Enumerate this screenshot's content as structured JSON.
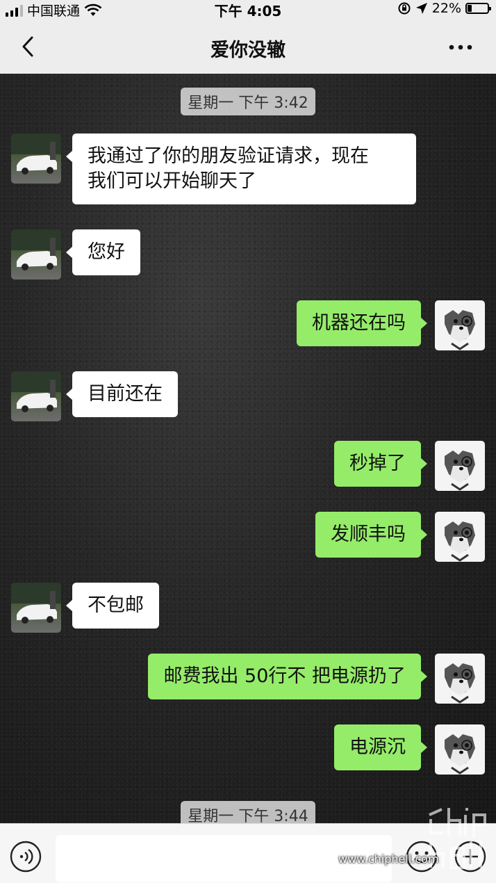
{
  "status_bar": {
    "carrier": "中国联通",
    "time": "下午 4:05",
    "battery_percent": "22%",
    "battery_level": 0.22
  },
  "nav": {
    "title": "爱你没辙",
    "back_icon": "chevron-left-icon",
    "more_icon": "more-dots-icon"
  },
  "chat": {
    "timestamps": [
      "星期一 下午 3:42",
      "星期一 下午 3:44"
    ],
    "messages": [
      {
        "side": "left",
        "text_line1": "我通过了你的朋友验证请求，现在",
        "text_line2": "我们可以开始聊天了"
      },
      {
        "side": "left",
        "text": "您好"
      },
      {
        "side": "right",
        "text": "机器还在吗"
      },
      {
        "side": "left",
        "text": "目前还在"
      },
      {
        "side": "right",
        "text": "秒掉了"
      },
      {
        "side": "right",
        "text": "发顺丰吗"
      },
      {
        "side": "left",
        "text": "不包邮"
      },
      {
        "side": "right",
        "text": "邮费我出 50行不 把电源扔了"
      },
      {
        "side": "right",
        "text": "电源沉"
      }
    ]
  },
  "input_bar": {
    "voice_icon": "voice-icon",
    "emoji_icon": "emoji-icon",
    "plus_icon": "plus-icon",
    "input_value": ""
  },
  "watermark": {
    "text": "www.chiphell.com"
  }
}
